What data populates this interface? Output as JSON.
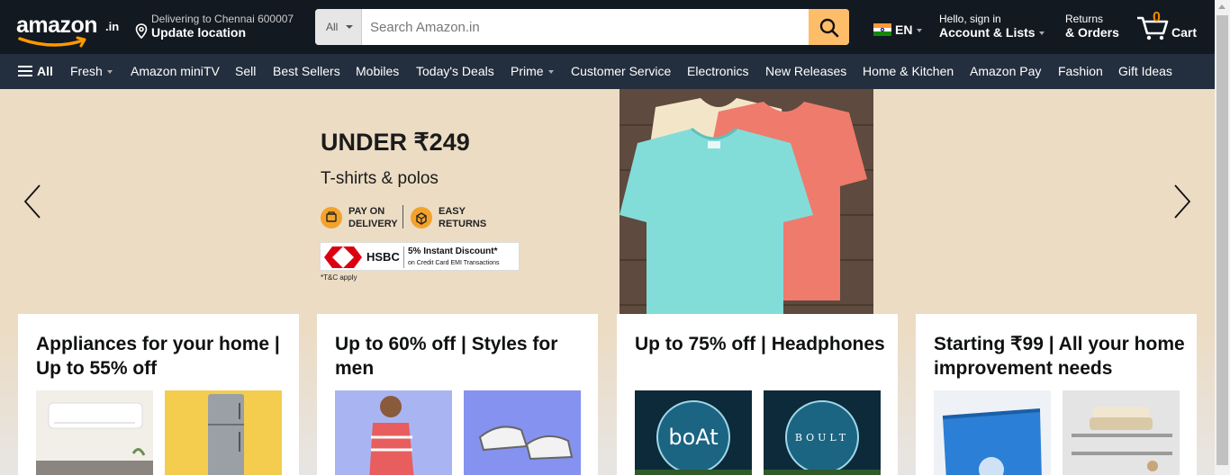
{
  "header": {
    "logo_text": "amazon",
    "logo_suffix": ".in",
    "location_line1": "Delivering to Chennai 600007",
    "location_line2": "Update location",
    "search": {
      "category": "All",
      "placeholder": "Search Amazon.in"
    },
    "language": "EN",
    "account_line1": "Hello, sign in",
    "account_line2": "Account & Lists",
    "orders_line1": "Returns",
    "orders_line2": "& Orders",
    "cart_count": "0",
    "cart_label": "Cart"
  },
  "subnav": {
    "all": "All",
    "items": [
      "Fresh",
      "Amazon miniTV",
      "Sell",
      "Best Sellers",
      "Mobiles",
      "Today's Deals",
      "Prime",
      "Customer Service",
      "Electronics",
      "New Releases",
      "Home & Kitchen",
      "Amazon Pay",
      "Fashion",
      "Gift Ideas"
    ]
  },
  "hero": {
    "headline": "UNDER ₹249",
    "subheadline": "T-shirts & polos",
    "badge1_line1": "PAY ON",
    "badge1_line2": "DELIVERY",
    "badge2_line1": "EASY",
    "badge2_line2": "RETURNS",
    "bank_name": "HSBC",
    "bank_offer": "5% Instant Discount*",
    "bank_offer_detail": "on Credit Card EMI Transactions",
    "terms": "*T&C apply"
  },
  "cards": [
    {
      "title": "Appliances for your home | Up to 55% off"
    },
    {
      "title": "Up to 60% off | Styles for men"
    },
    {
      "title": "Up to 75% off | Headphones"
    },
    {
      "title": "Starting ₹99 | All your home improvement needs"
    }
  ],
  "brand_labels": {
    "boat": "boAt",
    "boult": "BOULT"
  },
  "colors": {
    "nav_bg": "#131921",
    "subnav_bg": "#232f3e",
    "search_button": "#febd69",
    "cart_count": "#f08804",
    "hero_bg": "#ecdcc4"
  }
}
